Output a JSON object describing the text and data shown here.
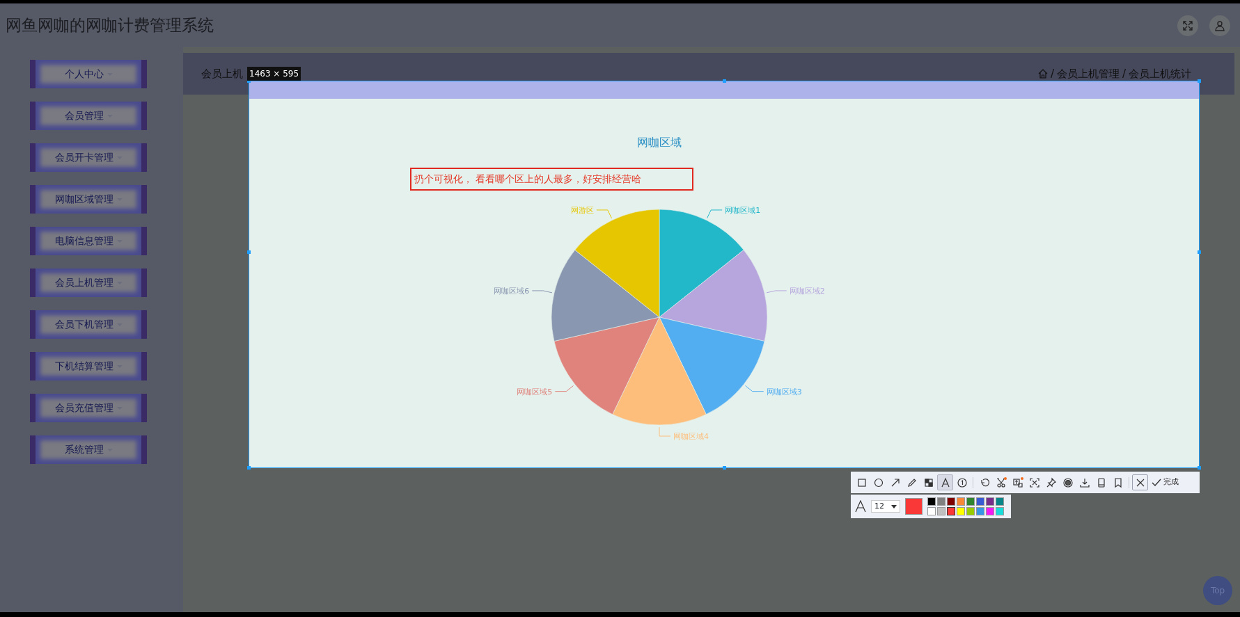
{
  "header": {
    "title": "网鱼网咖的网咖计费管理系统"
  },
  "sidebar": {
    "items": [
      {
        "label": "个人中心"
      },
      {
        "label": "会员管理"
      },
      {
        "label": "会员开卡管理"
      },
      {
        "label": "网咖区域管理"
      },
      {
        "label": "电脑信息管理"
      },
      {
        "label": "会员上机管理"
      },
      {
        "label": "会员下机管理"
      },
      {
        "label": "下机结算管理"
      },
      {
        "label": "会员充值管理"
      },
      {
        "label": "系统管理"
      }
    ]
  },
  "breadcrumb_bar": {
    "page_title": "会员上机",
    "separator": "/",
    "crumbs": [
      "会员上机管理",
      "会员上机统计"
    ]
  },
  "capture": {
    "size_label": "1463 × 595",
    "annotation": "扔个可视化， 看看哪个区上的人最多，好安排经营哈",
    "chart_data": {
      "type": "pie",
      "title": "网咖区域",
      "categories": [
        "网咖区域1",
        "网咖区域2",
        "网咖区域3",
        "网咖区域4",
        "网咖区域5",
        "网咖区域6",
        "网游区"
      ],
      "values": [
        1,
        1,
        1,
        1,
        1,
        1,
        1
      ],
      "colors": [
        "#22b7c9",
        "#b6a6dd",
        "#52aef1",
        "#fdbe7b",
        "#e0837c",
        "#8a97b0",
        "#e6c600"
      ]
    }
  },
  "capture_toolbar": {
    "tools": [
      {
        "selected": false,
        "hovered": false
      },
      {
        "selected": false,
        "hovered": false
      },
      {
        "selected": false,
        "hovered": false
      },
      {
        "selected": false,
        "hovered": false
      },
      {
        "selected": false,
        "hovered": false
      },
      {
        "selected": true,
        "hovered": false
      },
      {
        "selected": false,
        "hovered": false
      },
      {
        "selected": false,
        "hovered": false
      },
      {
        "selected": false,
        "hovered": false
      },
      {
        "selected": false,
        "hovered": false
      },
      {
        "selected": false,
        "hovered": false
      },
      {
        "selected": false,
        "hovered": false
      },
      {
        "selected": false,
        "hovered": false
      },
      {
        "selected": false,
        "hovered": false
      },
      {
        "selected": false,
        "hovered": false
      },
      {
        "selected": false,
        "hovered": false
      },
      {
        "selected": false,
        "hovered": true
      }
    ],
    "done_label": "完成",
    "font_size": "12",
    "palette": [
      {
        "color": "#000000",
        "selected": false
      },
      {
        "color": "#808080",
        "selected": false
      },
      {
        "color": "#800000",
        "selected": false
      },
      {
        "color": "#f7883a",
        "selected": false
      },
      {
        "color": "#308430",
        "selected": false
      },
      {
        "color": "#385ad3",
        "selected": false
      },
      {
        "color": "#772e8a",
        "selected": false
      },
      {
        "color": "#088588",
        "selected": false
      },
      {
        "color": "#ffffff",
        "selected": false
      },
      {
        "color": "#c0c0c0",
        "selected": false
      },
      {
        "color": "#fb3838",
        "selected": true
      },
      {
        "color": "#ffff00",
        "selected": false
      },
      {
        "color": "#99cc00",
        "selected": false
      },
      {
        "color": "#3894e4",
        "selected": false
      },
      {
        "color": "#f31bf3",
        "selected": false
      },
      {
        "color": "#16dcdc",
        "selected": false
      }
    ]
  },
  "back_to_top": "Top"
}
